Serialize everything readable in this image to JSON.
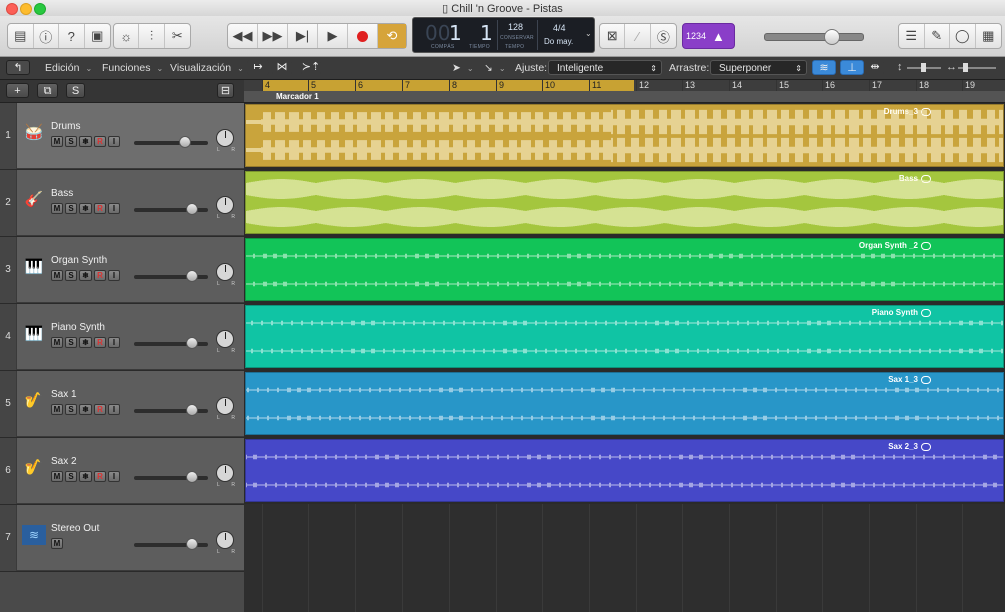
{
  "window": {
    "title": "Chill 'n Groove - Pistas"
  },
  "lcd": {
    "bar": "1",
    "beat": "1",
    "bar_label": "COMPÁS",
    "beat_label": "TIEMPO",
    "tempo": "128",
    "tempo_mode": "CONSERVAR",
    "tempo_label": "TEMPO",
    "signature": "4/4",
    "key": "Do may."
  },
  "count_in": "1234",
  "menus": {
    "edit": "Edición",
    "functions": "Funciones",
    "view": "Visualización"
  },
  "snap": {
    "label": "Ajuste:",
    "value": "Inteligente"
  },
  "drag": {
    "label": "Arrastre:",
    "value": "Superponer"
  },
  "ruler": {
    "bars": [
      "4",
      "5",
      "6",
      "7",
      "8",
      "9",
      "10",
      "11",
      "12",
      "13",
      "14",
      "15",
      "16",
      "17",
      "18",
      "19"
    ],
    "marker": "Marcador 1"
  },
  "tracks": [
    {
      "num": "1",
      "name": "Drums",
      "region": "Drums_3",
      "color": "#c9a43c"
    },
    {
      "num": "2",
      "name": "Bass",
      "region": "Bass",
      "color": "#a4c63e"
    },
    {
      "num": "3",
      "name": "Organ Synth",
      "region": "Organ Synth _2",
      "color": "#12c458"
    },
    {
      "num": "4",
      "name": "Piano Synth",
      "region": "Piano Synth",
      "color": "#10c4a4"
    },
    {
      "num": "5",
      "name": "Sax 1",
      "region": "Sax 1_3",
      "color": "#2896c8"
    },
    {
      "num": "6",
      "name": "Sax 2",
      "region": "Sax 2_3",
      "color": "#4648c8"
    },
    {
      "num": "7",
      "name": "Stereo Out"
    }
  ],
  "buttons": {
    "mute": "M",
    "solo": "S",
    "rec": "R",
    "input": "I",
    "add": "+",
    "s": "S"
  }
}
